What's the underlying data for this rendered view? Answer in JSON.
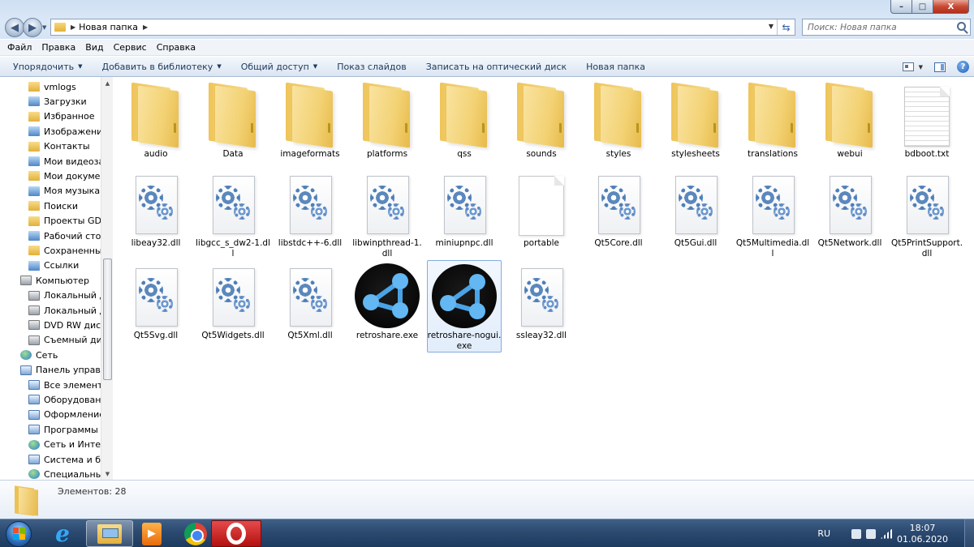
{
  "window": {
    "address_crumb": "Новая папка",
    "search_placeholder": "Поиск: Новая папка",
    "controls": {
      "minimize": "–",
      "maximize": "□",
      "close": "X"
    }
  },
  "menu": [
    "Файл",
    "Правка",
    "Вид",
    "Сервис",
    "Справка"
  ],
  "commands": [
    {
      "label": "Упорядочить",
      "dropdown": true
    },
    {
      "label": "Добавить в библиотеку",
      "dropdown": true
    },
    {
      "label": "Общий доступ",
      "dropdown": true
    },
    {
      "label": "Показ слайдов",
      "dropdown": false
    },
    {
      "label": "Записать на оптический диск",
      "dropdown": false
    },
    {
      "label": "Новая папка",
      "dropdown": false
    }
  ],
  "nav": [
    {
      "label": "vmlogs",
      "icon": "folder",
      "level": 1
    },
    {
      "label": "Загрузки",
      "icon": "downloads",
      "level": 1
    },
    {
      "label": "Избранное",
      "icon": "favorites",
      "level": 1
    },
    {
      "label": "Изображения",
      "icon": "pictures",
      "level": 1
    },
    {
      "label": "Контакты",
      "icon": "contacts",
      "level": 1
    },
    {
      "label": "Мои видеозап",
      "icon": "videos",
      "level": 1
    },
    {
      "label": "Мои документ",
      "icon": "documents",
      "level": 1
    },
    {
      "label": "Моя музыка",
      "icon": "music",
      "level": 1
    },
    {
      "label": "Поиски",
      "icon": "searches",
      "level": 1
    },
    {
      "label": "Проекты GDev",
      "icon": "folder",
      "level": 1
    },
    {
      "label": "Рабочий стол",
      "icon": "desktop",
      "level": 1
    },
    {
      "label": "Сохраненные",
      "icon": "saved-games",
      "level": 1
    },
    {
      "label": "Ссылки",
      "icon": "links",
      "level": 1
    },
    {
      "label": "Компьютер",
      "icon": "computer",
      "level": 0
    },
    {
      "label": "Локальный ди",
      "icon": "drive",
      "level": 1
    },
    {
      "label": "Локальный ди",
      "icon": "drive",
      "level": 1
    },
    {
      "label": "DVD RW диско",
      "icon": "dvd-drive",
      "level": 1
    },
    {
      "label": "Съемный диск",
      "icon": "removable-drive",
      "level": 1
    },
    {
      "label": "Сеть",
      "icon": "network",
      "level": 0
    },
    {
      "label": "Панель управле",
      "icon": "control-panel",
      "level": 0
    },
    {
      "label": "Все элементы",
      "icon": "control-panel",
      "level": 1
    },
    {
      "label": "Оборудование",
      "icon": "hardware",
      "level": 1
    },
    {
      "label": "Оформление и",
      "icon": "appearance",
      "level": 1
    },
    {
      "label": "Программы",
      "icon": "programs",
      "level": 1
    },
    {
      "label": "Сеть и Интерн",
      "icon": "network",
      "level": 1
    },
    {
      "label": "Система и без",
      "icon": "system-security",
      "level": 1
    },
    {
      "label": "Специальные",
      "icon": "ease-of-access",
      "level": 1
    }
  ],
  "files": [
    {
      "name": "audio",
      "type": "folder"
    },
    {
      "name": "Data",
      "type": "folder-docs"
    },
    {
      "name": "imageformats",
      "type": "folder"
    },
    {
      "name": "platforms",
      "type": "folder"
    },
    {
      "name": "qss",
      "type": "folder-docs"
    },
    {
      "name": "sounds",
      "type": "folder"
    },
    {
      "name": "styles",
      "type": "folder"
    },
    {
      "name": "stylesheets",
      "type": "folder-docs"
    },
    {
      "name": "translations",
      "type": "folder"
    },
    {
      "name": "webui",
      "type": "folder"
    },
    {
      "name": "bdboot.txt",
      "type": "text"
    },
    {
      "name": "libeay32.dll",
      "type": "dll"
    },
    {
      "name": "libgcc_s_dw2-1.dll",
      "type": "dll"
    },
    {
      "name": "libstdc++-6.dll",
      "type": "dll"
    },
    {
      "name": "libwinpthread-1.dll",
      "type": "dll"
    },
    {
      "name": "miniupnpc.dll",
      "type": "dll"
    },
    {
      "name": "portable",
      "type": "blank"
    },
    {
      "name": "Qt5Core.dll",
      "type": "dll"
    },
    {
      "name": "Qt5Gui.dll",
      "type": "dll"
    },
    {
      "name": "Qt5Multimedia.dll",
      "type": "dll"
    },
    {
      "name": "Qt5Network.dll",
      "type": "dll"
    },
    {
      "name": "Qt5PrintSupport.dll",
      "type": "dll"
    },
    {
      "name": "Qt5Svg.dll",
      "type": "dll"
    },
    {
      "name": "Qt5Widgets.dll",
      "type": "dll"
    },
    {
      "name": "Qt5Xml.dll",
      "type": "dll"
    },
    {
      "name": "retroshare.exe",
      "type": "exe"
    },
    {
      "name": "retroshare-nogui.exe",
      "type": "exe",
      "selected": true
    },
    {
      "name": "ssleay32.dll",
      "type": "dll"
    }
  ],
  "status": {
    "count_text": "Элементов: 28"
  },
  "taskbar": {
    "apps": [
      "internet-explorer",
      "windows-explorer",
      "media-player",
      "chrome",
      "opera"
    ],
    "tray": {
      "lang": "RU",
      "time": "18:07",
      "date": "01.06.2020"
    }
  },
  "colors": {
    "folder": "#f3d274",
    "selection": "#84acdd",
    "taskbar": "#2c4a70"
  }
}
